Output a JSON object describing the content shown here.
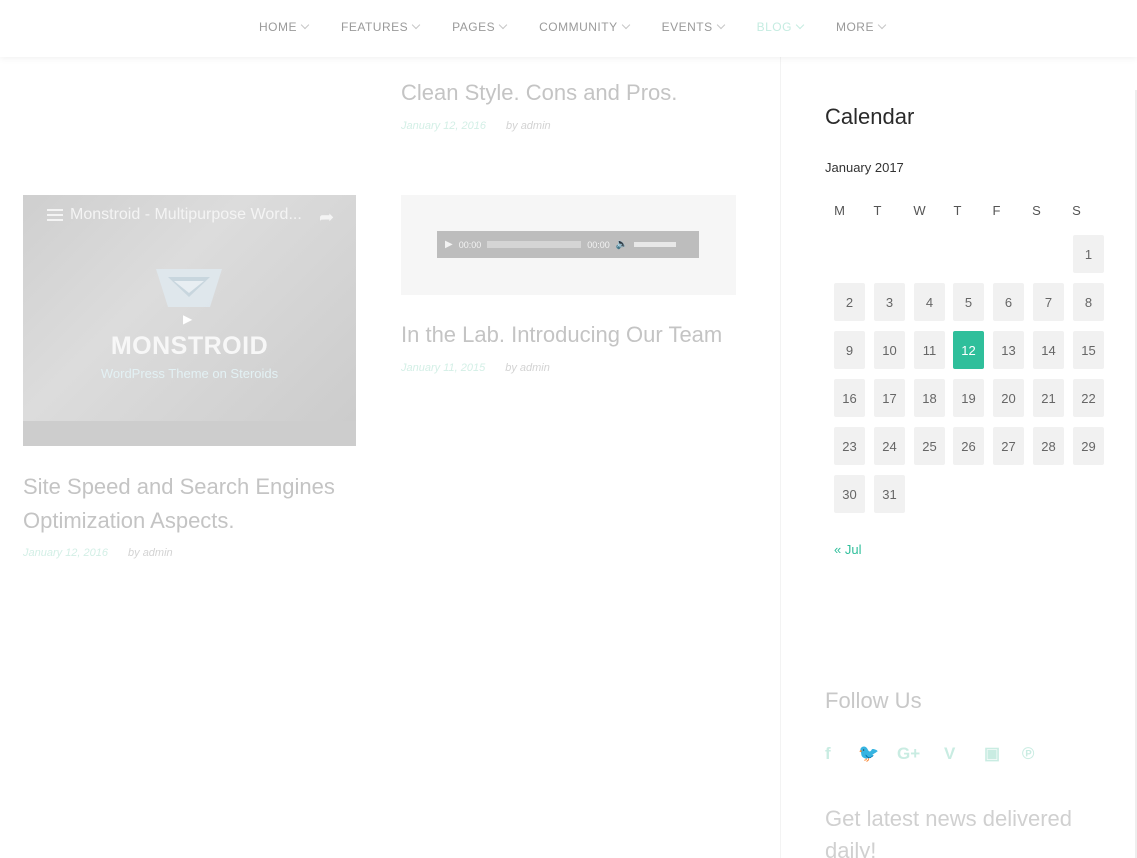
{
  "nav": {
    "items": [
      {
        "label": "HOME"
      },
      {
        "label": "FEATURES"
      },
      {
        "label": "PAGES"
      },
      {
        "label": "COMMUNITY"
      },
      {
        "label": "EVENTS"
      },
      {
        "label": "BLOG",
        "active": true
      },
      {
        "label": "MORE"
      }
    ]
  },
  "posts": [
    {
      "title": "Clean Style. Cons and Pros.",
      "date": "January 12, 2016",
      "author": "by admin"
    },
    {
      "title": "Site Speed and Search Engines Optimization Aspects.",
      "date": "January 12, 2016",
      "author": "by admin"
    },
    {
      "title": "In the Lab. Introducing Our Team",
      "date": "January 11, 2015",
      "author": "by admin"
    }
  ],
  "video": {
    "title": "Monstroid - Multipurpose Word...",
    "brand": "MONSTROID",
    "tagline": "WordPress Theme on Steroids",
    "icons": {
      "playlist": "playlist-icon",
      "share": "share-icon",
      "play": "play-icon"
    }
  },
  "audio": {
    "current": "00:00",
    "duration": "00:00",
    "icons": {
      "play": "play-icon",
      "volume": "volume-icon"
    }
  },
  "calendar": {
    "widget_title": "Calendar",
    "caption": "January 2017",
    "weekdays": [
      "M",
      "T",
      "W",
      "T",
      "F",
      "S",
      "S"
    ],
    "days": [
      "1",
      "2",
      "3",
      "4",
      "5",
      "6",
      "7",
      "8",
      "9",
      "10",
      "11",
      "12",
      "13",
      "14",
      "15",
      "16",
      "17",
      "18",
      "19",
      "20",
      "21",
      "22",
      "23",
      "24",
      "25",
      "26",
      "27",
      "28",
      "29",
      "30",
      "31"
    ],
    "today": "12",
    "prev_link": "« Jul"
  },
  "follow": {
    "title": "Follow Us",
    "icons": [
      "facebook-icon",
      "twitter-icon",
      "google-plus-icon",
      "vimeo-icon",
      "youtube-icon",
      "pinterest-icon"
    ]
  },
  "newsletter": {
    "title": "Get latest news delivered daily!"
  },
  "colors": {
    "accent": "#2fbf9b",
    "today_bg": "#2fbf9b",
    "cell_bg": "#f1f1f1"
  }
}
